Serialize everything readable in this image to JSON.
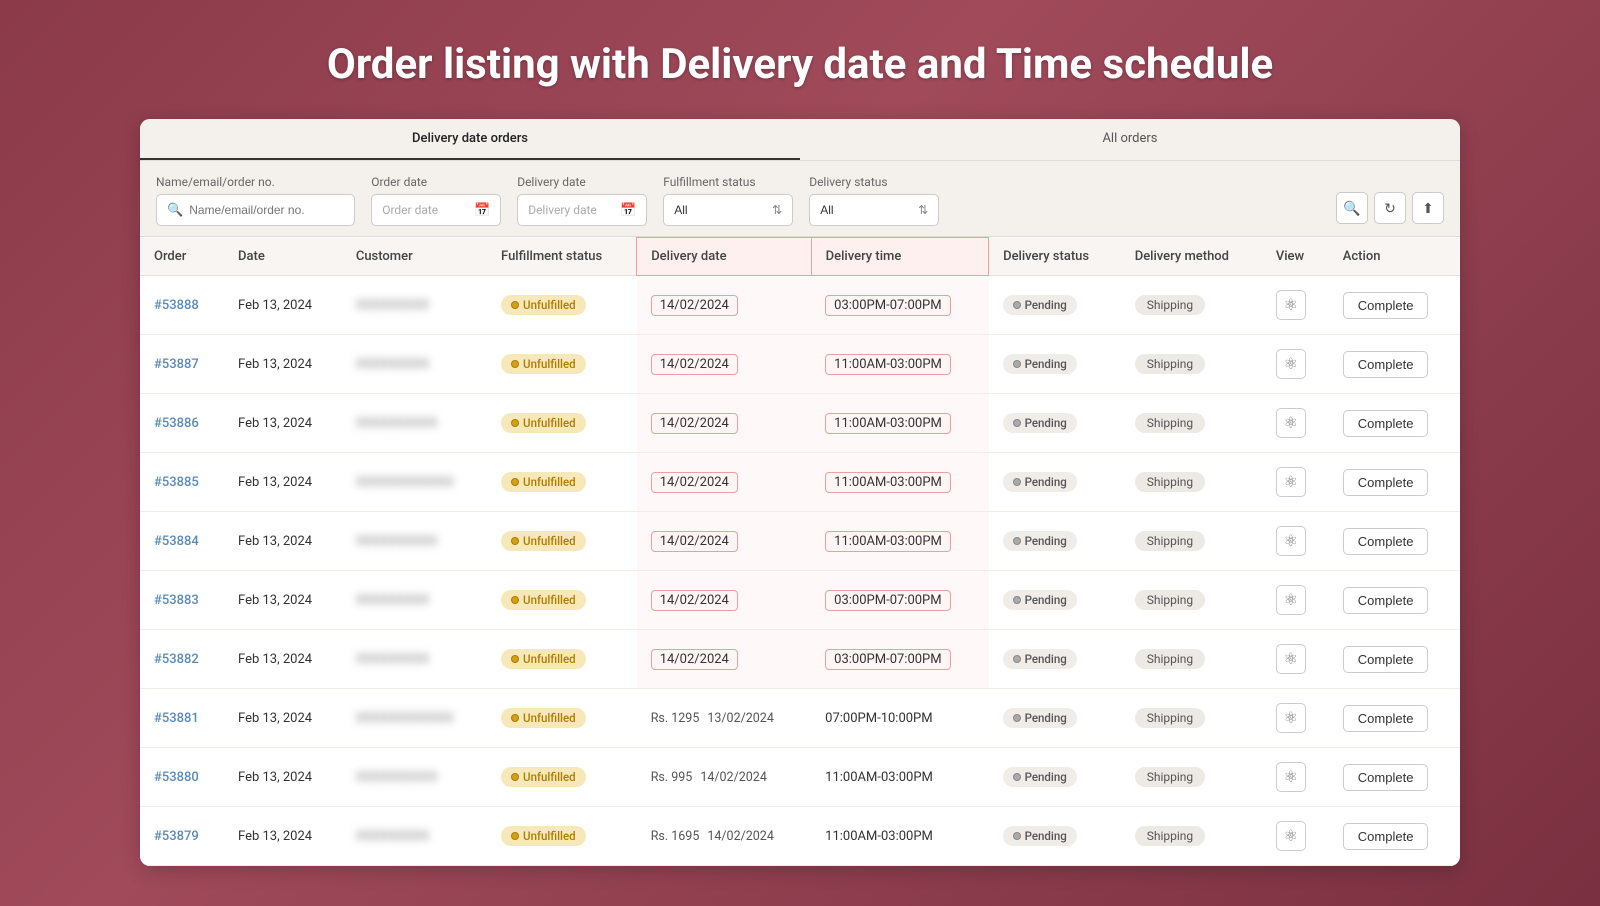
{
  "page": {
    "title": "Order listing with Delivery date and Time schedule"
  },
  "tabs": [
    {
      "id": "delivery",
      "label": "Delivery date orders",
      "active": true
    },
    {
      "id": "all",
      "label": "All orders",
      "active": false
    }
  ],
  "filters": {
    "name_label": "Name/email/order no.",
    "name_placeholder": "Name/email/order no.",
    "order_date_label": "Order date",
    "order_date_placeholder": "Order date",
    "delivery_date_label": "Delivery date",
    "delivery_date_placeholder": "Delivery date",
    "fulfillment_label": "Fulfillment status",
    "fulfillment_value": "All",
    "delivery_status_label": "Delivery status",
    "delivery_status_value": "All"
  },
  "columns": [
    "Order",
    "Date",
    "Customer",
    "Fulfillment status",
    "Delivery date",
    "Delivery time",
    "Delivery status",
    "Delivery method",
    "View",
    "Action"
  ],
  "rows": [
    {
      "order": "#53888",
      "date": "Feb 13, 2024",
      "customer": "XXXXXXXXX",
      "fulfillment": "Unfulfilled",
      "delivery_date": "14/02/2024",
      "delivery_time": "03:00PM-07:00PM",
      "delivery_status": "Pending",
      "delivery_method": "Shipping",
      "action": "Complete",
      "highlight": true
    },
    {
      "order": "#53887",
      "date": "Feb 13, 2024",
      "customer": "XXXXXXXXX",
      "fulfillment": "Unfulfilled",
      "delivery_date": "14/02/2024",
      "delivery_time": "11:00AM-03:00PM",
      "delivery_status": "Pending",
      "delivery_method": "Shipping",
      "action": "Complete",
      "highlight": true
    },
    {
      "order": "#53886",
      "date": "Feb 13, 2024",
      "customer": "XXXXXXXXXX",
      "fulfillment": "Unfulfilled",
      "delivery_date": "14/02/2024",
      "delivery_time": "11:00AM-03:00PM",
      "delivery_status": "Pending",
      "delivery_method": "Shipping",
      "action": "Complete",
      "highlight": true
    },
    {
      "order": "#53885",
      "date": "Feb 13, 2024",
      "customer": "XXXXXXXXXXXX",
      "fulfillment": "Unfulfilled",
      "delivery_date": "14/02/2024",
      "delivery_time": "11:00AM-03:00PM",
      "delivery_status": "Pending",
      "delivery_method": "Shipping",
      "action": "Complete",
      "highlight": true
    },
    {
      "order": "#53884",
      "date": "Feb 13, 2024",
      "customer": "XXXXXXXXXX",
      "fulfillment": "Unfulfilled",
      "delivery_date": "14/02/2024",
      "delivery_time": "11:00AM-03:00PM",
      "delivery_status": "Pending",
      "delivery_method": "Shipping",
      "action": "Complete",
      "highlight": true
    },
    {
      "order": "#53883",
      "date": "Feb 13, 2024",
      "customer": "XXXXXXXXX",
      "fulfillment": "Unfulfilled",
      "delivery_date": "14/02/2024",
      "delivery_time": "03:00PM-07:00PM",
      "delivery_status": "Pending",
      "delivery_method": "Shipping",
      "action": "Complete",
      "highlight": true
    },
    {
      "order": "#53882",
      "date": "Feb 13, 2024",
      "customer": "XXXXXXXXX",
      "fulfillment": "Unfulfilled",
      "delivery_date": "14/02/2024",
      "delivery_time": "03:00PM-07:00PM",
      "delivery_status": "Pending",
      "delivery_method": "Shipping",
      "action": "Complete",
      "highlight": true
    },
    {
      "order": "#53881",
      "date": "Feb 13, 2024",
      "customer": "XXXXXXXXXXXX",
      "fulfillment": "Unfulfilled",
      "delivery_price": "Rs. 1295",
      "delivery_date": "13/02/2024",
      "delivery_time": "07:00PM-10:00PM",
      "delivery_status": "Pending",
      "delivery_method": "Shipping",
      "action": "Complete",
      "highlight": false
    },
    {
      "order": "#53880",
      "date": "Feb 13, 2024",
      "customer": "XXXXXXXXXX",
      "fulfillment": "Unfulfilled",
      "delivery_price": "Rs. 995",
      "delivery_date": "14/02/2024",
      "delivery_time": "11:00AM-03:00PM",
      "delivery_status": "Pending",
      "delivery_method": "Shipping",
      "action": "Complete",
      "highlight": false
    },
    {
      "order": "#53879",
      "date": "Feb 13, 2024",
      "customer": "XXXXXXXXX",
      "fulfillment": "Unfulfilled",
      "delivery_price": "Rs. 1695",
      "delivery_date": "14/02/2024",
      "delivery_time": "11:00AM-03:00PM",
      "delivery_status": "Pending",
      "delivery_method": "Shipping",
      "action": "Complete",
      "highlight": false
    }
  ],
  "icons": {
    "search": "🔍",
    "calendar": "📅",
    "refresh": "↻",
    "upload": "⬆",
    "eye": "👁",
    "chevron_ud": "⇅"
  }
}
